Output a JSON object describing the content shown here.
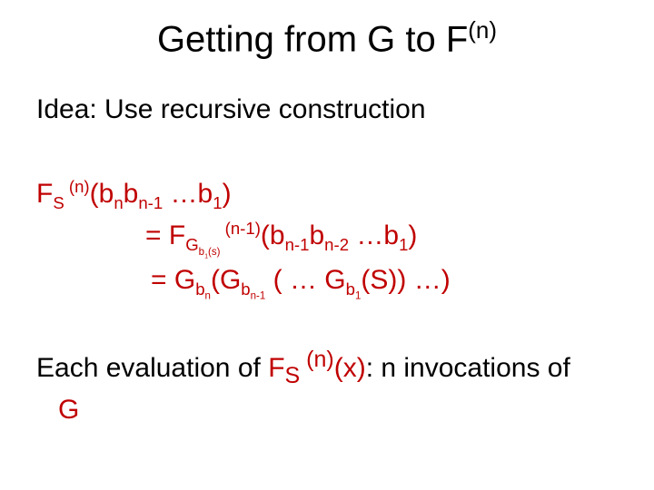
{
  "title": {
    "prefix": "Getting from G to F",
    "sup": "(n)"
  },
  "idea": "Idea: Use recursive construction",
  "formula": {
    "l1_F": "F",
    "l1_sub1": "S",
    "l1_sup1": " (n)",
    "l1_open": "(b",
    "l1_subn": "n",
    "l1_b2": "b",
    "l1_subn1": "n-1",
    "l1_dots": " …b",
    "l1_sub3": "1",
    "l1_close": ")",
    "l2_eq": "= F",
    "l2_sub1": "G",
    "l2_sub2": "b",
    "l2_sub3": "1",
    "l2_sub4": "(s)",
    "l2_sup": " (n-1)",
    "l2_open": "(b",
    "l2_subn1": "n-1",
    "l2_b2": "b",
    "l2_subn2": "n-2",
    "l2_dots": " …b",
    "l2_sub5": "1",
    "l2_close": ")",
    "l3_eq": "= G",
    "l3_sub1": "b",
    "l3_sub2": "n",
    "l3_g2": "(G",
    "l3_sub3": "b",
    "l3_sub4": "n-1",
    "l3_mid": " (  … G",
    "l3_sub5": "b",
    "l3_sub6": "1",
    "l3_end": "(S)) …)"
  },
  "summary": {
    "s1": "Each evaluation of ",
    "f": "F",
    "sub": "S",
    "sup": " (n)",
    "expr": "(x)",
    "s2": ": n invocations of",
    "g": "G"
  }
}
